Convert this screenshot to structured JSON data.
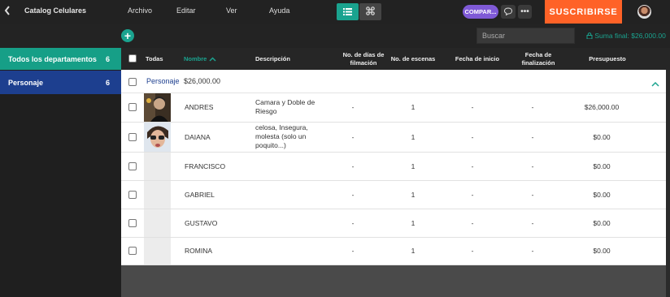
{
  "app": {
    "title": "Catalog Celulares"
  },
  "menu": {
    "items": [
      "Archivo",
      "Editar",
      "Ver",
      "Ayuda"
    ]
  },
  "toolbar": {
    "compare_label": "COMPAR...",
    "more_label": "•••",
    "subscribe_label": "SUSCRIBIRSE",
    "accent_color": "#1aa38f",
    "subscribe_color": "#ff6227",
    "compare_color": "#7f5ad6"
  },
  "search": {
    "placeholder": "Buscar",
    "value": ""
  },
  "summary": {
    "label": "Suma final: $26,000.00"
  },
  "sidebar": {
    "items": [
      {
        "label": "Todos los departamentos",
        "count": "6"
      },
      {
        "label": "Personaje",
        "count": "6"
      }
    ]
  },
  "table": {
    "headers": {
      "all": "Todas",
      "name": "Nombre",
      "description": "Descripción",
      "days_line1": "No. de días de",
      "days_line2": "filmación",
      "scenes": "No. de escenas",
      "start": "Fecha de inicio",
      "end_line1": "Fecha de",
      "end_line2": "finalización",
      "budget": "Presupuesto"
    },
    "group": {
      "name": "Personaje",
      "sum": "$26,000.00"
    },
    "rows": [
      {
        "name": "ANDRES",
        "desc": "Camara y Doble de Riesgo",
        "days": "-",
        "scenes": "1",
        "start": "-",
        "end": "-",
        "budget": "$26,000.00",
        "photo": "man-photo"
      },
      {
        "name": "DAIANA",
        "desc": "celosa, Insegura, molesta (solo un poquito...)",
        "days": "-",
        "scenes": "1",
        "start": "-",
        "end": "-",
        "budget": "$0.00",
        "photo": "woman-photo"
      },
      {
        "name": "FRANCISCO",
        "desc": "",
        "days": "-",
        "scenes": "1",
        "start": "-",
        "end": "-",
        "budget": "$0.00",
        "photo": ""
      },
      {
        "name": "GABRIEL",
        "desc": "",
        "days": "-",
        "scenes": "1",
        "start": "-",
        "end": "-",
        "budget": "$0.00",
        "photo": ""
      },
      {
        "name": "GUSTAVO",
        "desc": "",
        "days": "-",
        "scenes": "1",
        "start": "-",
        "end": "-",
        "budget": "$0.00",
        "photo": ""
      },
      {
        "name": "ROMINA",
        "desc": "",
        "days": "-",
        "scenes": "1",
        "start": "-",
        "end": "-",
        "budget": "$0.00",
        "photo": ""
      }
    ]
  }
}
